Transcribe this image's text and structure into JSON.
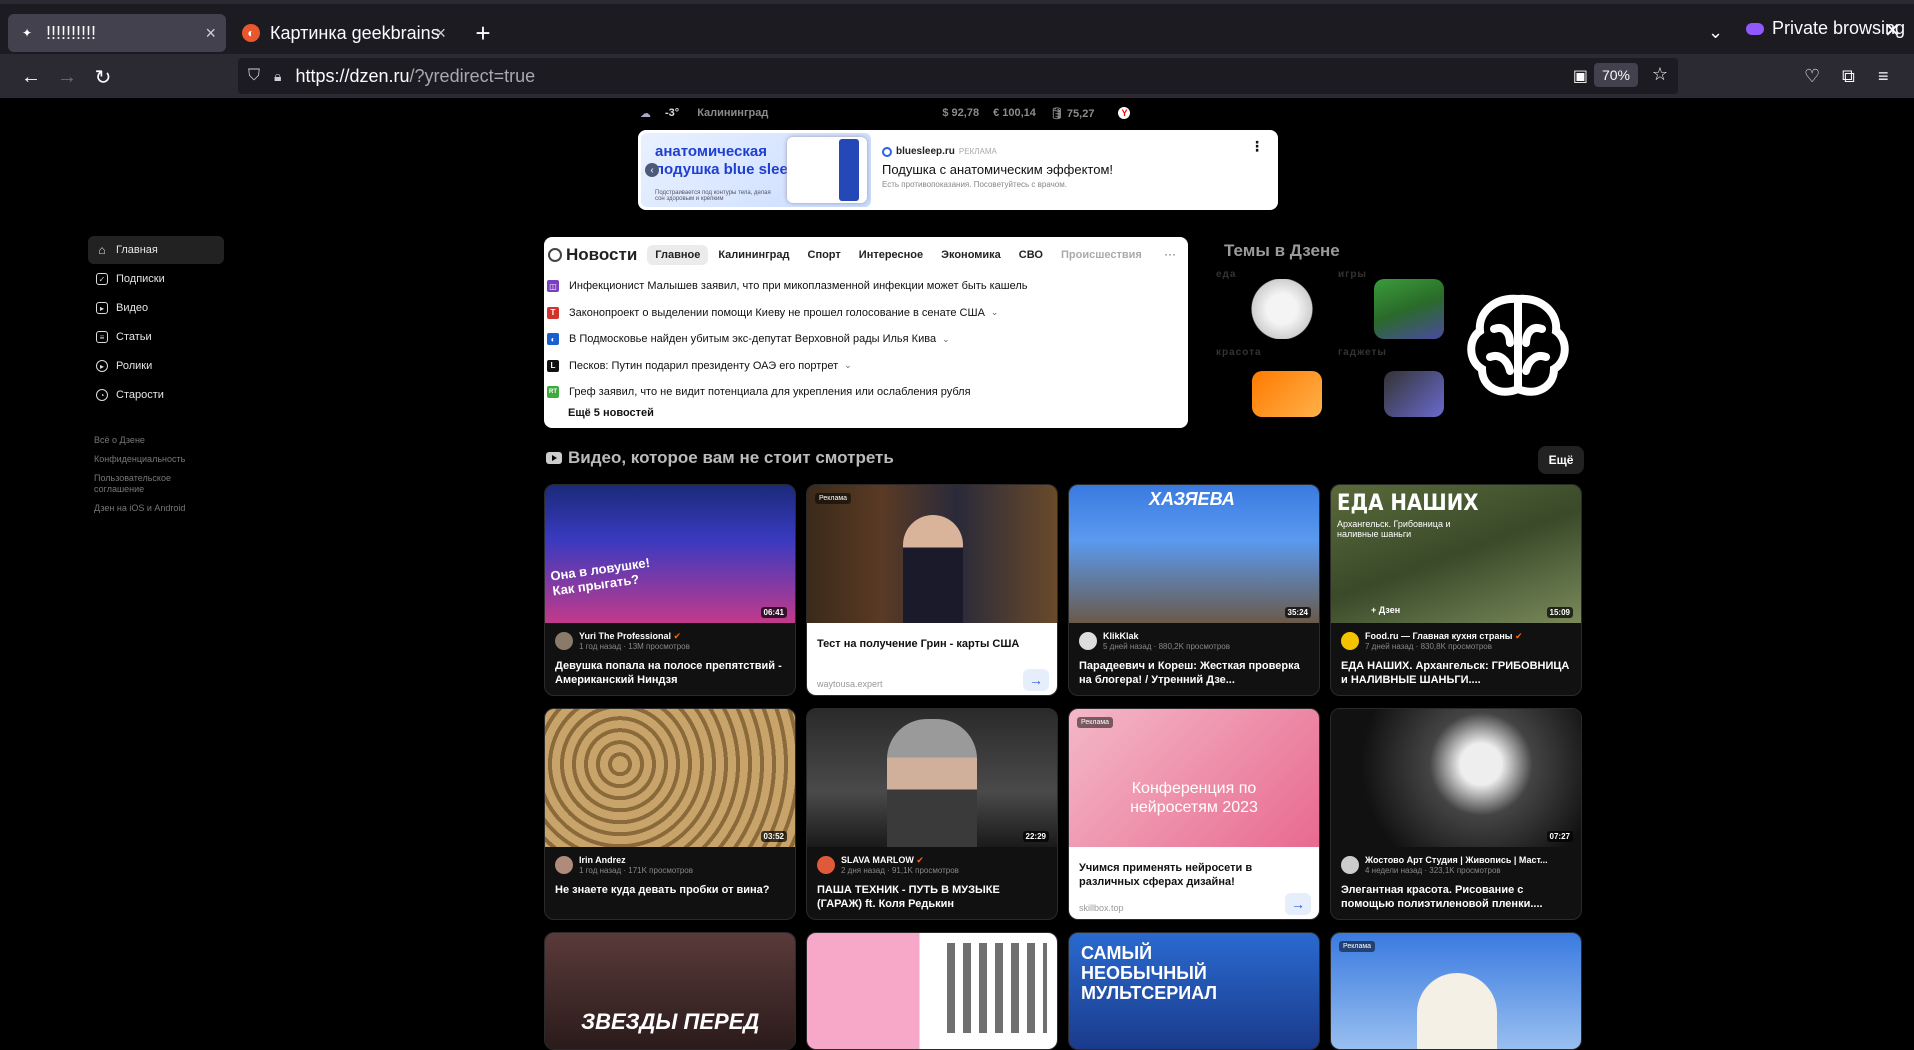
{
  "browser": {
    "tabs": [
      {
        "label": "!!!!!!!!!!",
        "active": true
      },
      {
        "label": "Картинка geekbrains",
        "active": false
      }
    ],
    "new_tab": "+",
    "private_label": "Private browsing",
    "url_host": "https://dzen.ru",
    "url_path": "/?yredirect=true",
    "zoom": "70%"
  },
  "topinfo": {
    "temp": "-3°",
    "city": "Калининград",
    "usd": "$ 92,78",
    "eur": "€ 100,14",
    "oil": "🛢 75,27"
  },
  "banner": {
    "img_title_1": "анатомическая",
    "img_title_2": "подушка blue sleep",
    "img_small": "Подстраивается под контуры тела, делая сон здоровым и крепким",
    "source": "bluesleep.ru",
    "ad_label": "РЕКЛАМА",
    "title": "Подушка с анатомическим эффектом!",
    "desc": "Есть противопоказания. Посоветуйтесь с врачом."
  },
  "sidebar": {
    "items": [
      {
        "label": "Главная"
      },
      {
        "label": "Подписки"
      },
      {
        "label": "Видео"
      },
      {
        "label": "Статьи"
      },
      {
        "label": "Ролики"
      },
      {
        "label": "Старости"
      }
    ],
    "links": [
      "Всё о Дзене",
      "Конфиденциальность",
      "Пользовательское соглашение",
      "Дзен на iOS и Android"
    ]
  },
  "news": {
    "title": "Новости",
    "tabs": [
      "Главное",
      "Калининград",
      "Спорт",
      "Интересное",
      "Экономика",
      "СВО",
      "Происшествия"
    ],
    "items": [
      {
        "text": "Инфекционист Малышев заявил, что при микоплазменной инфекции может быть кашель",
        "color": "#7a3fbf"
      },
      {
        "text": "Законопроект о выделении помощи Киеву не прошел голосование в сенате США",
        "color": "#d0342c"
      },
      {
        "text": "В Подмосковье найден убитым экс-депутат Верховной рады Илья Кива",
        "color": "#1a5fd0"
      },
      {
        "text": "Песков: Путин подарил президенту ОАЭ его портрет",
        "color": "#111111"
      },
      {
        "text": "Греф заявил, что не видит потенциала для укрепления или ослабления рубля",
        "color": "#3caa3c"
      }
    ],
    "more": "Ещё 5 новостей"
  },
  "themes": {
    "title": "Темы в Дзене",
    "items": [
      "еда",
      "игры",
      "красота",
      "гаджеты"
    ]
  },
  "video_section": {
    "title": "Видео, которое вам не стоит смотреть",
    "more": "Ещё",
    "ad_label": "Реклама",
    "cards": [
      {
        "channel": "Yuri The Professional",
        "stats": "1 год назад · 13M просмотров",
        "title": "Девушка попала на полосе препятствий - Американский Ниндзя",
        "duration": "06:41",
        "overlay": "Она в ловушке! Как прыгать?"
      },
      {
        "ad_title": "Тест на получение Грин - карты США",
        "ad_src": "waytousa.expert"
      },
      {
        "channel": "KlikKlak",
        "stats": "5 дней назад · 880,2K просмотров",
        "title": "Парадеевич и Кореш: Жесткая проверка на блогера! / Утренний Дзе...",
        "duration": "35:24",
        "overlay": "ХАЗЯЕВА"
      },
      {
        "channel": "Food.ru — Главная кухня страны",
        "stats": "7 дней назад · 830,8K просмотров",
        "title": "ЕДА НАШИХ. Архангельск: ГРИБОВНИЦА и НАЛИВНЫЕ ШАНЬГИ....",
        "duration": "15:09",
        "overlay": "ЕДА НАШИХ",
        "overlay_sub": "Архангельск. Грибовница и наливные шаньги",
        "overlay_badge": "+ Дзен"
      },
      {
        "channel": "Irin Andrez",
        "stats": "1 год назад · 171K просмотров",
        "title": "Не знаете куда девать пробки от вина?",
        "duration": "03:52"
      },
      {
        "channel": "SLAVA MARLOW",
        "stats": "2 дня назад · 91,1K просмотров",
        "title": "ПАША ТЕХНИК - ПУТЬ В МУЗЫКЕ (ГАРАЖ) ft. Коля Редькин",
        "duration": "22:29"
      },
      {
        "ad_title": "Учимся применять нейросети в различных сферах дизайна!",
        "ad_src": "skillbox.top",
        "overlay": "Конференция по нейросетям 2023"
      },
      {
        "channel": "Жостово Арт Студия | Живопись | Маст...",
        "stats": "4 недели назад · 323,1K просмотров",
        "title": "Элегантная красота. Рисование с помощью полиэтиленовой пленки....",
        "duration": "07:27"
      }
    ],
    "row3": [
      "ЗВЕЗДЫ ПЕРЕД",
      "",
      "САМЫЙ НЕОБЫЧНЫЙ МУЛЬТСЕРИАЛ",
      "Реклама"
    ]
  }
}
